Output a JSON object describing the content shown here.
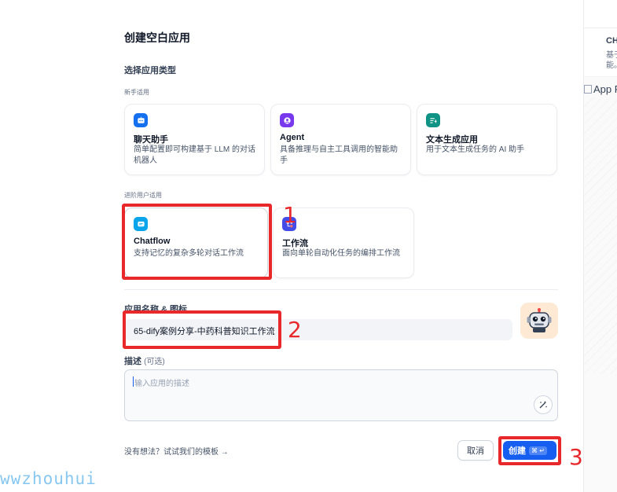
{
  "dialog": {
    "title": "创建空白应用",
    "section_title": "选择应用类型",
    "beginner_label": "新手适用",
    "advanced_label": "进阶用户适用",
    "app_types_beginner": [
      {
        "name": "聊天助手",
        "desc": "简单配置即可构建基于 LLM 的对话机器人",
        "icon": "chat-bot-icon",
        "color": "#1570ef"
      },
      {
        "name": "Agent",
        "desc": "具备推理与自主工具调用的智能助手",
        "icon": "agent-icon",
        "color": "#7839ee"
      },
      {
        "name": "文本生成应用",
        "desc": "用于文本生成任务的 AI 助手",
        "icon": "text-generation-icon",
        "color": "#0e9384"
      }
    ],
    "app_types_advanced": [
      {
        "name": "Chatflow",
        "desc": "支持记忆的复杂多轮对话工作流",
        "icon": "chatflow-icon",
        "color": "#0ba5ec"
      },
      {
        "name": "工作流",
        "desc": "面向单轮自动化任务的编排工作流",
        "icon": "workflow-icon",
        "color": "#444ce7"
      }
    ],
    "name_label": "应用名称 & 图标",
    "name_value": "65-dify案例分享-中药科普知识工作流",
    "desc_label": "描述",
    "desc_optional": "(可选)",
    "desc_placeholder": "输入应用的描述",
    "template_link": "没有想法？试试我们的模板 →",
    "cancel_label": "取消",
    "create_label": "创建",
    "create_shortcut": "⌘ ↵"
  },
  "annotations": [
    "1",
    "2",
    "3"
  ],
  "right_panel": {
    "title": "CHA",
    "desc": "基于 能。",
    "image_alt": "App P"
  },
  "watermark": "wwzhouhui",
  "colors": {
    "primary": "#155eef",
    "annotation_red": "#e8282b",
    "avatar_bg": "#fde9d4"
  }
}
